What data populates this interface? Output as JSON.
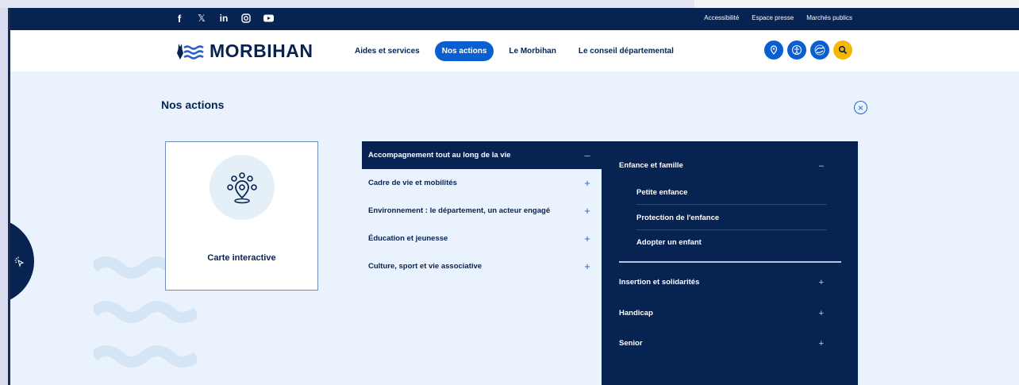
{
  "topbar": {
    "links": [
      "Accessibilité",
      "Espace presse",
      "Marchés publics"
    ],
    "social_icons": [
      "facebook-icon",
      "x-icon",
      "linkedin-icon",
      "instagram-icon",
      "youtube-icon"
    ]
  },
  "header": {
    "logo_text": "MORBIHAN",
    "nav": [
      {
        "label": "Aides et services",
        "active": false
      },
      {
        "label": "Nos actions",
        "active": true
      },
      {
        "label": "Le Morbihan",
        "active": false
      },
      {
        "label": "Le conseil départemental",
        "active": false
      }
    ],
    "icons": [
      "map-pin-icon",
      "accessibility-icon",
      "sign-language-icon",
      "search-icon"
    ]
  },
  "panel": {
    "title": "Nos actions",
    "close_icon": "close-icon",
    "card": {
      "label": "Carte interactive",
      "icon": "map-pin-people-icon"
    },
    "menu": [
      {
        "label": "Accompagnement tout au long de la vie",
        "sign": "–",
        "active": true
      },
      {
        "label": "Cadre de vie et mobilités",
        "sign": "+",
        "active": false
      },
      {
        "label": "Environnement : le département, un acteur engagé",
        "sign": "+",
        "active": false
      },
      {
        "label": "Éducation et jeunesse",
        "sign": "+",
        "active": false
      },
      {
        "label": "Culture, sport et vie associative",
        "sign": "+",
        "active": false
      }
    ],
    "submenu": {
      "open_group": {
        "label": "Enfance et famille",
        "sign": "–",
        "links": [
          "Petite enfance",
          "Protection de l'enfance",
          "Adopter un enfant"
        ]
      },
      "groups": [
        {
          "label": "Insertion et solidarités",
          "sign": "+"
        },
        {
          "label": "Handicap",
          "sign": "+"
        },
        {
          "label": "Senior",
          "sign": "+"
        }
      ]
    }
  },
  "colors": {
    "navy": "#062352",
    "accent_blue": "#0a5fd0",
    "search_yellow": "#f6b700",
    "panel_bg": "#eaf3fd"
  }
}
